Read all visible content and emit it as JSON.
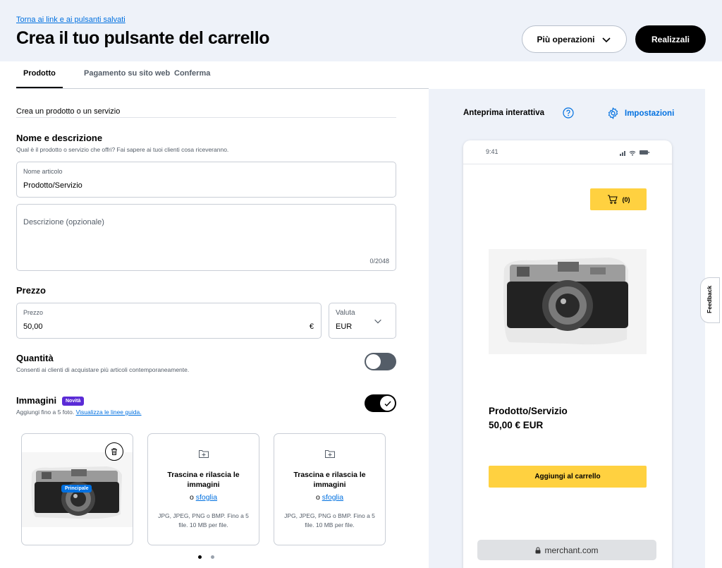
{
  "header": {
    "back_link": "Torna ai link e ai pulsanti salvati",
    "title": "Crea il tuo pulsante del carrello",
    "more_actions": "Più operazioni",
    "build_button": "Realizzali"
  },
  "tabs": [
    {
      "label": "Prodotto",
      "active": true
    },
    {
      "label": "Pagamento su sito web",
      "active": false
    },
    {
      "label": "Conferma",
      "active": false
    }
  ],
  "form": {
    "section_heading": "Crea un prodotto o un servizio",
    "name_desc": {
      "title": "Nome e descrizione",
      "subtitle": "Qual è il prodotto o servizio che offri? Fai sapere ai tuoi clienti cosa riceveranno.",
      "item_label": "Nome articolo",
      "item_value": "Prodotto/Servizio",
      "description_placeholder": "Descrizione (opzionale)",
      "description_counter": "0/2048"
    },
    "price": {
      "title": "Prezzo",
      "price_label": "Prezzo",
      "price_value": "50,00",
      "currency_symbol": "€",
      "currency_label": "Valuta",
      "currency_value": "EUR"
    },
    "quantity": {
      "title": "Quantità",
      "subtitle": "Consenti ai clienti di acquistare più articoli contemporaneamente.",
      "enabled": false
    },
    "images": {
      "title": "Immagini",
      "badge": "Novità",
      "subtitle_prefix": "Aggiungi fino a 5 foto.",
      "guidelines_link": "Visualizza le linee guida.",
      "enabled": true,
      "primary_badge": "Principale",
      "upload_title": "Trascina e rilascia le immagini",
      "upload_or": "o",
      "upload_browse": "sfoglia",
      "upload_hint": "JPG, JPEG, PNG o BMP. Fino a 5 file. 10 MB per file.",
      "carousel_page": 1,
      "carousel_pages": 2
    }
  },
  "preview": {
    "title": "Anteprima interattiva",
    "settings_label": "Impostazioni",
    "status_time": "9:41",
    "cart_label": "(0)",
    "product_name": "Prodotto/Servizio",
    "product_price": "50,00 € EUR",
    "add_to_cart": "Aggiungi al carrello",
    "url": "merchant.com"
  },
  "feedback": {
    "label": "Feedback"
  },
  "colors": {
    "accent_blue": "#0070e0",
    "cart_yellow": "#ffd140",
    "badge_purple": "#5b2bd6",
    "panel_bg": "#eef2f9"
  }
}
